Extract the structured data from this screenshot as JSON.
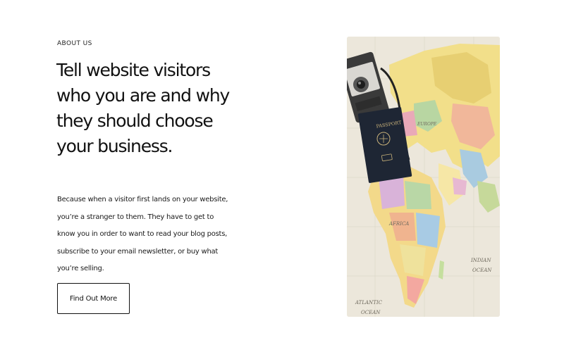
{
  "about": {
    "eyebrow": "ABOUT US",
    "headline": "Tell website visitors who you are and why they should choose your business.",
    "body": "Because when a visitor first lands on your website, you’re a stranger to them. They have to get to know you in order to want to read your blog posts, subscribe to your email newsletter, or buy what you’re selling.",
    "cta_label": "Find Out More"
  },
  "photo": {
    "passport_label": "PASSPORT",
    "map_labels": {
      "indian": "INDIAN",
      "indian_ocean": "OCEAN",
      "atlantic": "ATLANTIC",
      "atlantic_ocean": "OCEAN",
      "europe": "EUROPE",
      "africa": "AFRICA"
    }
  }
}
